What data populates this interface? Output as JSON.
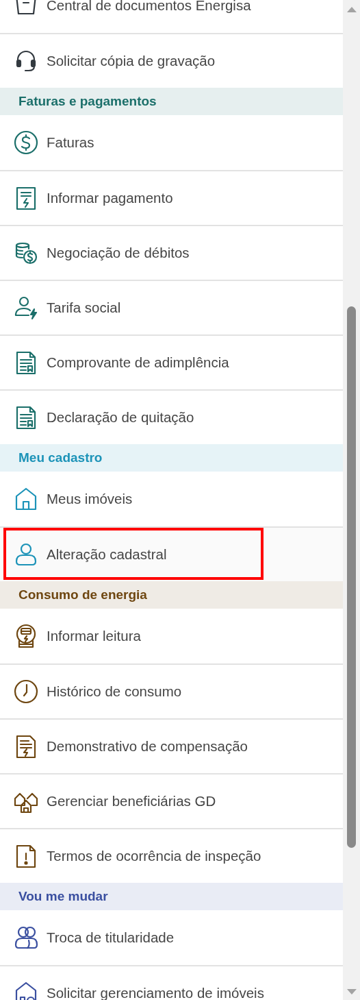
{
  "groups": [
    {
      "color": "#333a40",
      "items": [
        {
          "label": "Central de documentos Energisa",
          "kind": "tray",
          "selected": false
        },
        {
          "label": "Solicitar cópia de gravação",
          "kind": "headset",
          "selected": false
        }
      ]
    },
    {
      "title": "Faturas e pagamentos",
      "color": "#1b6f6a",
      "items": [
        {
          "label": "Faturas",
          "kind": "dollar",
          "selected": false
        },
        {
          "label": "Informar pagamento",
          "kind": "receipt",
          "selected": false
        },
        {
          "label": "Negociação de débitos",
          "kind": "coins",
          "selected": false
        },
        {
          "label": "Tarifa social",
          "kind": "person-bolt",
          "selected": false
        },
        {
          "label": "Comprovante de adimplência",
          "kind": "doc-lines",
          "selected": false
        },
        {
          "label": "Declaração de quitação",
          "kind": "doc-lines",
          "selected": false
        }
      ]
    },
    {
      "title": "Meu cadastro",
      "color": "#1c93b8",
      "items": [
        {
          "label": "Meus imóveis",
          "kind": "house",
          "selected": false
        },
        {
          "label": "Alteração cadastral",
          "kind": "person",
          "selected": true
        }
      ]
    },
    {
      "title": "Consumo de energia",
      "color": "#6e4610",
      "items": [
        {
          "label": "Informar leitura",
          "kind": "meter",
          "selected": false
        },
        {
          "label": "Histórico de consumo",
          "kind": "clock",
          "selected": false
        },
        {
          "label": "Demonstrativo de compensação",
          "kind": "doc-bolt",
          "selected": false
        },
        {
          "label": "Gerenciar beneficiárias GD",
          "kind": "houses",
          "selected": false
        },
        {
          "label": "Termos de ocorrência de inspeção",
          "kind": "doc-alert",
          "selected": false
        }
      ]
    },
    {
      "title": "Vou me mudar",
      "color": "#3a4fa0",
      "items": [
        {
          "label": "Troca de titularidade",
          "kind": "people",
          "selected": false
        },
        {
          "label": "Solicitar gerenciamento de imóveis",
          "kind": "house-gear",
          "selected": false
        }
      ]
    }
  ]
}
